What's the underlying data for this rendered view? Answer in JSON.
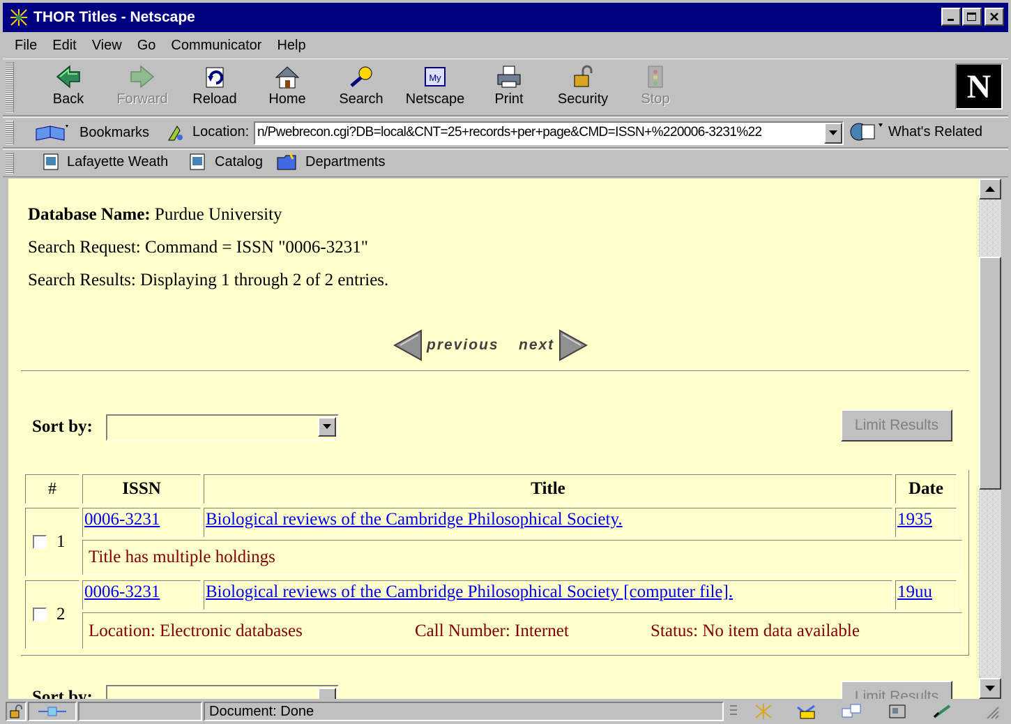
{
  "window": {
    "title": "THOR Titles - Netscape"
  },
  "menu": [
    "File",
    "Edit",
    "View",
    "Go",
    "Communicator",
    "Help"
  ],
  "nav": {
    "back": "Back",
    "forward": "Forward",
    "reload": "Reload",
    "home": "Home",
    "search": "Search",
    "netscape": "Netscape",
    "print": "Print",
    "security": "Security",
    "stop": "Stop"
  },
  "location": {
    "bookmarks": "Bookmarks",
    "label": "Location:",
    "url": "n/Pwebrecon.cgi?DB=local&CNT=25+records+per+page&CMD=ISSN+%220006-3231%22",
    "whats_related": "What's Related"
  },
  "personal": [
    "Lafayette Weath",
    "Catalog",
    "Departments"
  ],
  "page": {
    "db_label": "Database Name:",
    "db_value": "Purdue University",
    "search_request": "Search Request: Command = ISSN \"0006-3231\"",
    "search_results": "Search Results: Displaying 1 through 2 of 2 entries.",
    "previous": "previous",
    "next": "next",
    "sort_label": "Sort by:",
    "sort_value": "",
    "limit_button": "Limit Results",
    "headers": {
      "num": "#",
      "issn": "ISSN",
      "title": "Title",
      "date": "Date"
    },
    "rows": [
      {
        "num": "1",
        "issn": "0006-3231",
        "title": "Biological reviews of the Cambridge Philosophical Society.",
        "date": "1935",
        "note": "Title has multiple holdings"
      },
      {
        "num": "2",
        "issn": "0006-3231",
        "title": "Biological reviews of the Cambridge Philosophical Society [computer file].",
        "date": "19uu",
        "location": "Location: Electronic databases",
        "call_number": "Call Number: Internet",
        "status": "Status: No item data available"
      }
    ],
    "sort_label_bottom": "Sort by:",
    "limit_button_bottom": "Limit Results"
  },
  "status": {
    "text": "Document: Done"
  },
  "colors": {
    "page_bg": "#ffffcc",
    "titlebar": "#000080",
    "link": "#0000ee",
    "note": "#800000"
  }
}
